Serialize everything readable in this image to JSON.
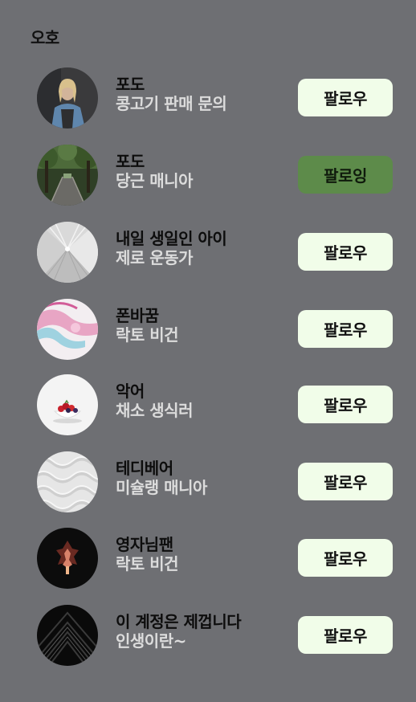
{
  "section": {
    "title": "오호"
  },
  "users": [
    {
      "name": "포도",
      "subtitle": "콩고기 판매 문의",
      "button": "팔로우",
      "following": false,
      "avatar": "person-portrait"
    },
    {
      "name": "포도",
      "subtitle": "당근 매니아",
      "button": "팔로잉",
      "following": true,
      "avatar": "forest-bridge"
    },
    {
      "name": "내일 생일인 아이",
      "subtitle": "제로 운동가",
      "button": "팔로우",
      "following": false,
      "avatar": "white-tunnel"
    },
    {
      "name": "폰바꿈",
      "subtitle": "락토 비건",
      "button": "팔로우",
      "following": false,
      "avatar": "pink-marble"
    },
    {
      "name": "악어",
      "subtitle": "채소 생식러",
      "button": "팔로우",
      "following": false,
      "avatar": "strawberry-bowl"
    },
    {
      "name": "테디베어",
      "subtitle": "미슐랭 매니아",
      "button": "팔로우",
      "following": false,
      "avatar": "white-pattern"
    },
    {
      "name": "영자님팬",
      "subtitle": "락토 비건",
      "button": "팔로우",
      "following": false,
      "avatar": "dark-symmetry"
    },
    {
      "name": "이 계정은 제껍니다",
      "subtitle": "인생이란~",
      "button": "팔로우",
      "following": false,
      "avatar": "black-chevrons"
    }
  ]
}
